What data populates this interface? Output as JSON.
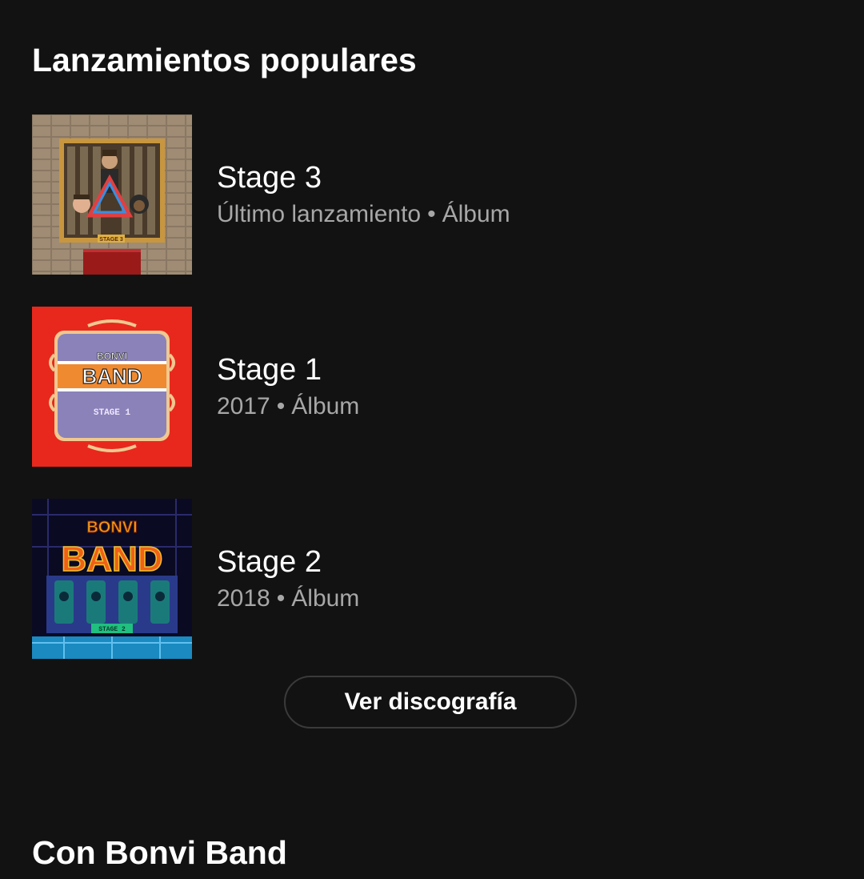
{
  "section_popular": {
    "title": "Lanzamientos populares"
  },
  "releases": [
    {
      "title": "Stage 3",
      "subtitle_left": "Último lanzamiento",
      "separator": "•",
      "subtitle_right": "Álbum",
      "cover_text": "STAGE 3"
    },
    {
      "title": "Stage 1",
      "subtitle_left": "2017",
      "separator": "•",
      "subtitle_right": "Álbum",
      "cover_text_top": "BONVI",
      "cover_text_main": "BAND",
      "cover_text_stage": "STAGE 1"
    },
    {
      "title": "Stage 2",
      "subtitle_left": "2018",
      "separator": "•",
      "subtitle_right": "Álbum",
      "cover_text_top": "BONVI",
      "cover_text_main": "BAND",
      "cover_text_stage": "STAGE 2"
    }
  ],
  "discography_button": {
    "label": "Ver discografía"
  },
  "section_with": {
    "title": "Con Bonvi Band"
  },
  "colors": {
    "background": "#121212",
    "text_primary": "#ffffff",
    "text_secondary": "#a7a7a7",
    "button_border": "#3a3a3a"
  }
}
